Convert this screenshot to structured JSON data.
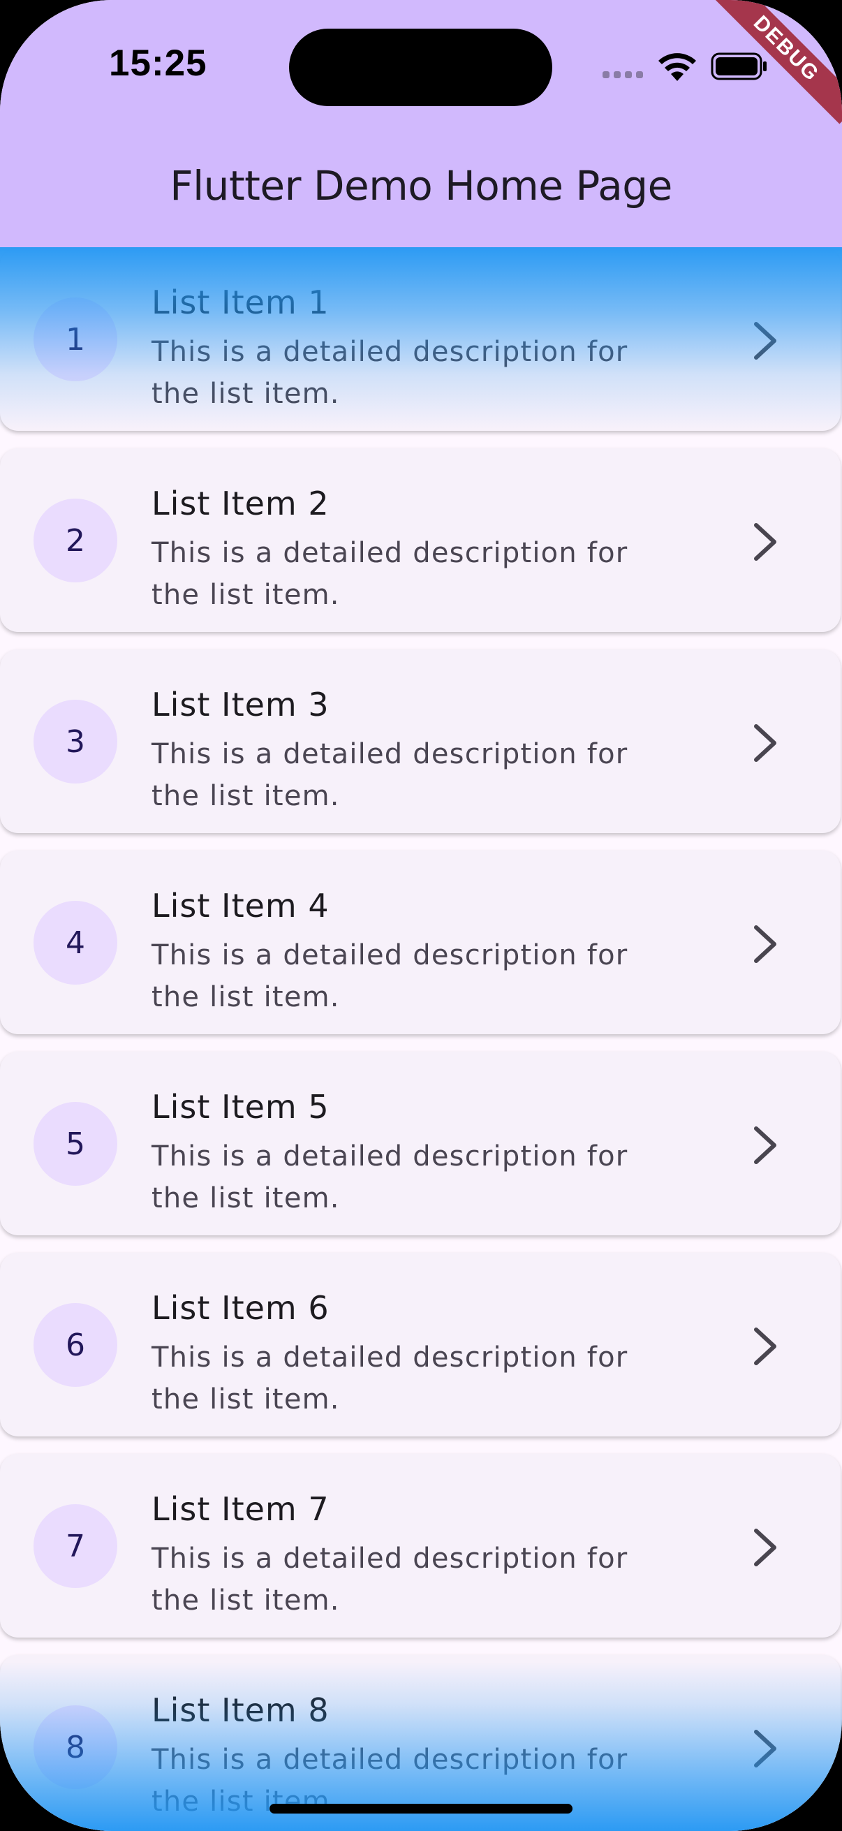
{
  "status_bar": {
    "time": "15:25"
  },
  "debug_banner": "DEBUG",
  "app_bar": {
    "title": "Flutter Demo Home Page"
  },
  "list": {
    "items": [
      {
        "avatar": "1",
        "title": "List Item 1",
        "description": "This is a detailed description for the list item."
      },
      {
        "avatar": "2",
        "title": "List Item 2",
        "description": "This is a detailed description for the list item."
      },
      {
        "avatar": "3",
        "title": "List Item 3",
        "description": "This is a detailed description for the list item."
      },
      {
        "avatar": "4",
        "title": "List Item 4",
        "description": "This is a detailed description for the list item."
      },
      {
        "avatar": "5",
        "title": "List Item 5",
        "description": "This is a detailed description for the list item."
      },
      {
        "avatar": "6",
        "title": "List Item 6",
        "description": "This is a detailed description for the list item."
      },
      {
        "avatar": "7",
        "title": "List Item 7",
        "description": "This is a detailed description for the list item."
      },
      {
        "avatar": "8",
        "title": "List Item 8",
        "description": "This is a detailed description for the list item."
      }
    ],
    "trailing_icon": "chevron-right-icon"
  },
  "colors": {
    "app_bar": "#d1b9fd",
    "background": "#fef7ff",
    "card": "#f7f1fa",
    "avatar": "#eadcfe",
    "fade": "#2196f3",
    "debug_ribbon": "#a5364c"
  }
}
